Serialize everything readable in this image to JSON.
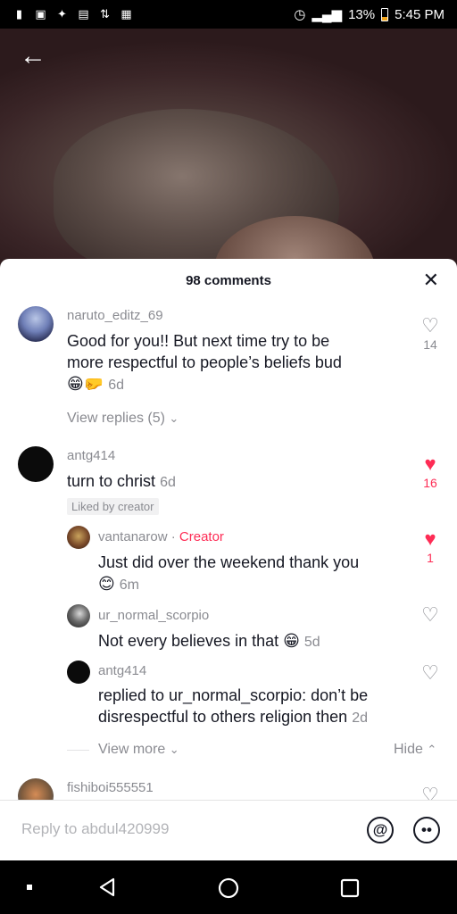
{
  "status_bar": {
    "battery": "13%",
    "time": "5:45 PM"
  },
  "sheet": {
    "title": "98 comments"
  },
  "comments": [
    {
      "username": "naruto_editz_69",
      "text_line1": "Good for you!! But next time try to be",
      "text_line2": "more respectful to people’s beliefs bud",
      "emoji": "😁🤛",
      "time": "6d",
      "likes": "14",
      "view_replies": "View replies (5)"
    },
    {
      "username": "antg414",
      "text": "turn to christ",
      "time": "6d",
      "likes": "16",
      "liked_by_creator": "Liked by creator",
      "replies": [
        {
          "username": "vantanarow",
          "creator_label": "Creator",
          "text": "Just did over the weekend thank you",
          "emoji": "😊",
          "time": "6m",
          "likes": "1"
        },
        {
          "username": "ur_normal_scorpio",
          "text": "Not every believes in that",
          "emoji": "😁",
          "time": "5d"
        },
        {
          "username": "antg414",
          "text_line1": "replied to ur_normal_scorpio: don’t be",
          "text_line2": "disrespectful to others religion then",
          "time": "2d"
        }
      ],
      "view_more": "View more",
      "hide": "Hide"
    },
    {
      "username": "fishiboi555551"
    }
  ],
  "reply_bar": {
    "placeholder": "Reply to abdul420999"
  },
  "colors": {
    "accent": "#fe2c55",
    "muted": "#8a8b91",
    "text": "#161823"
  }
}
